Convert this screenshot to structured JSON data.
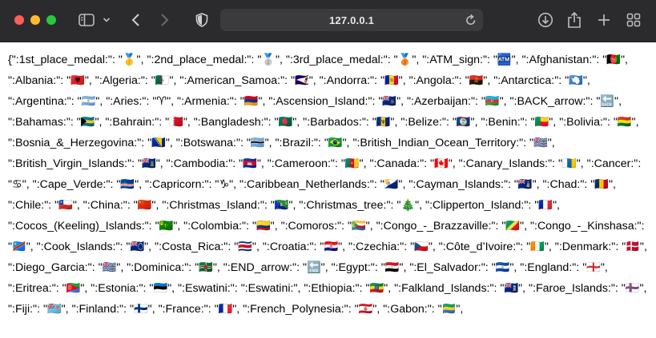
{
  "browser": {
    "url": "127.0.0.1"
  },
  "page": {
    "json_text": "{\":1st_place_medal:\": \"🥇\", \":2nd_place_medal:\": \"🥈\", \":3rd_place_medal:\": \"🥉\", \":ATM_sign:\": \"🏧\", \":Afghanistan:\": \"🇦🇫\", \":Albania:\": \"🇦🇱\", \":Algeria:\": \"🇩🇿\", \":American_Samoa:\": \"🇦🇸\", \":Andorra:\": \"🇦🇩\", \":Angola:\": \"🇦🇴\", \":Antarctica:\": \"🇦🇶\", \":Argentina:\": \"🇦🇷\", \":Aries:\": \"♈\", \":Armenia:\": \"🇦🇲\", \":Ascension_Island:\": \"🇦🇨\", \":Azerbaijan:\": \"🇦🇿\", \":BACK_arrow:\": \"🔙\", \":Bahamas:\": \"🇧🇸\", \":Bahrain:\": \"🇧🇭\", \":Bangladesh:\": \"🇧🇩\", \":Barbados:\": \"🇧🇧\", \":Belize:\": \"🇧🇿\", \":Benin:\": \"🇧🇯\", \":Bolivia:\": \"🇧🇴\", \":Bosnia_&_Herzegovina:\": \"🇧🇦\", \":Botswana:\": \"🇧🇼\", \":Brazil:\": \"🇧🇷\", \":British_Indian_Ocean_Territory:\": \"🇮🇴\", \":British_Virgin_Islands:\": \"🇻🇬\", \":Cambodia:\": \"🇰🇭\", \":Cameroon:\": \"🇨🇲\", \":Canada:\": \"🇨🇦\", \":Canary_Islands:\": \"🇮🇨\", \":Cancer:\": \"♋\", \":Cape_Verde:\": \"🇨🇻\", \":Capricorn:\": \"♑\", \":Caribbean_Netherlands:\": \"🇧🇶\", \":Cayman_Islands:\": \"🇰🇾\", \":Chad:\": \"🇹🇩\", \":Chile:\": \"🇨🇱\", \":China:\": \"🇨🇳\", \":Christmas_Island:\": \"🇨🇽\", \":Christmas_tree:\": \"🎄\", \":Clipperton_Island:\": \"🇨🇵\", \":Cocos_(Keeling)_Islands:\": \"🇨🇨\", \":Colombia:\": \"🇨🇴\", \":Comoros:\": \"🇰🇲\", \":Congo_-_Brazzaville:\": \"🇨🇬\", \":Congo_-_Kinshasa:\": \"🇨🇩\", \":Cook_Islands:\": \"🇨🇰\", \":Costa_Rica:\": \"🇨🇷\", \":Croatia:\": \"🇭🇷\", \":Czechia:\": \"🇨🇿\", \":Côte_d’Ivoire:\": \"🇨🇮\", \":Denmark:\": \"🇩🇰\", \":Diego_Garcia:\": \"🇩🇬\", \":Dominica:\": \"🇩🇲\", \":END_arrow:\": \"🔚\", \":Egypt:\": \"🇪🇬\", \":El_Salvador:\": \"🇸🇻\", \":England:\": \"🏴󠁧󠁢󠁥󠁮󠁧󠁿\", \":Eritrea:\": \"🇪🇷\", \":Estonia:\": \"🇪🇪\", \":Eswatini:\": \":Eswatini:\", \":Ethiopia:\": \"🇪🇹\", \":Falkland_Islands:\": \"🇫🇰\", \":Faroe_Islands:\": \"🇫🇴\", \":Fiji:\": \"🇫🇯\", \":Finland:\": \"🇫🇮\", \":France:\": \"🇫🇷\", \":French_Polynesia:\": \"🇵🇫\", \":Gabon:\": \"🇬🇦\","
  },
  "colors": {
    "toolbar_bg": "#2b2b2d",
    "close": "#ff5f57",
    "minimize": "#febc2e",
    "zoom": "#28c840"
  },
  "icons": [
    "sidebar-icon",
    "chevron-down-icon",
    "back-icon",
    "forward-icon",
    "shield-icon",
    "reload-icon",
    "download-icon",
    "share-icon",
    "new-tab-icon",
    "tab-overview-icon"
  ]
}
